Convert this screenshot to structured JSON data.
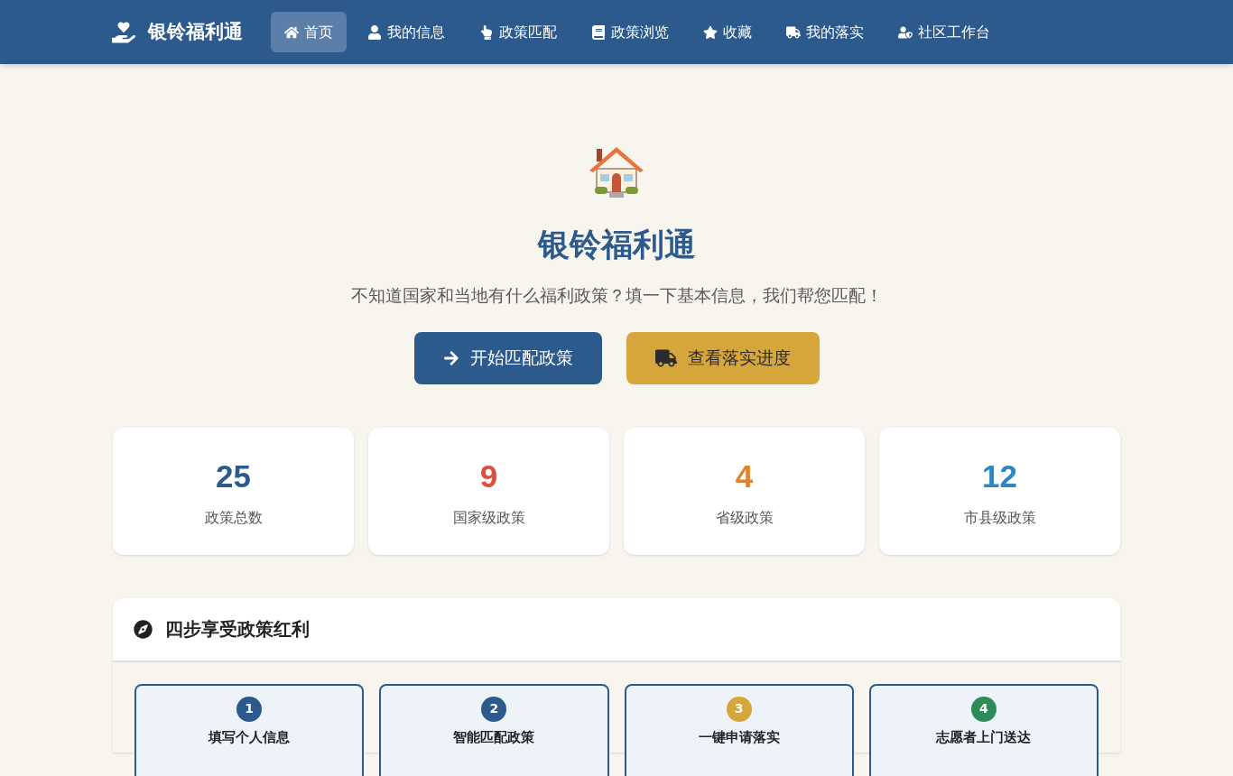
{
  "brand": {
    "title": "银铃福利通"
  },
  "nav": [
    {
      "label": "首页",
      "selected": true
    },
    {
      "label": "我的信息",
      "selected": false
    },
    {
      "label": "政策匹配",
      "selected": false
    },
    {
      "label": "政策浏览",
      "selected": false
    },
    {
      "label": "收藏",
      "selected": false
    },
    {
      "label": "我的落实",
      "selected": false
    },
    {
      "label": "社区工作台",
      "selected": false
    }
  ],
  "hero": {
    "title": "银铃福利通",
    "subtitle": "不知道国家和当地有什么福利政策？填一下基本信息，我们帮您匹配！",
    "buttons": [
      {
        "label": "开始匹配政策",
        "kind": "primary"
      },
      {
        "label": "查看落实进度",
        "kind": "secondary"
      }
    ]
  },
  "stats": [
    {
      "value": "25",
      "label": "政策总数",
      "color": "#2c5a8c"
    },
    {
      "value": "9",
      "label": "国家级政策",
      "color": "#e04e3c"
    },
    {
      "value": "4",
      "label": "省级政策",
      "color": "#e0822a"
    },
    {
      "value": "12",
      "label": "市县级政策",
      "color": "#2e86c1"
    }
  ],
  "steps_panel": {
    "title": "四步享受政策红利",
    "steps": [
      {
        "number": "1",
        "title": "填写个人信息",
        "color": "#2c5a8c"
      },
      {
        "number": "2",
        "title": "智能匹配政策",
        "color": "#2c5a8c"
      },
      {
        "number": "3",
        "title": "一键申请落实",
        "color": "#d4a63c"
      },
      {
        "number": "4",
        "title": "志愿者上门送达",
        "color": "#2e8b57"
      }
    ]
  }
}
